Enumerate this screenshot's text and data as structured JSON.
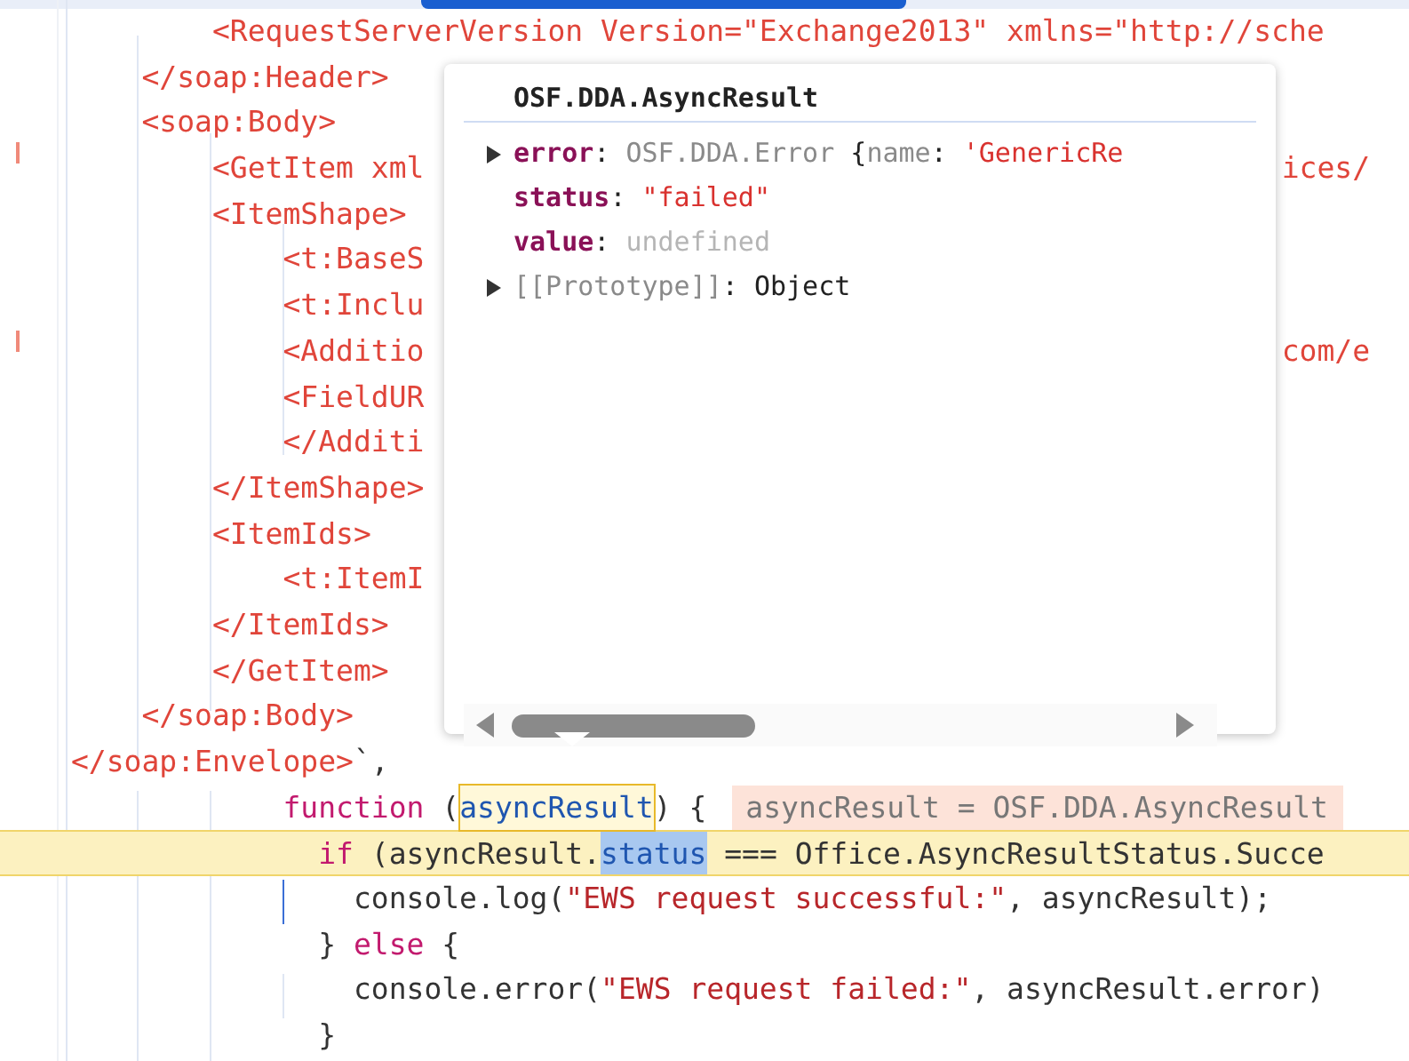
{
  "editor": {
    "lines": [
      {
        "current": false,
        "segments": [
          {
            "kind": "tag",
            "text": "        <RequestServerVersion Version=\"Exchange2013\" xmlns=\"http://sche"
          }
        ]
      },
      {
        "current": false,
        "segments": [
          {
            "kind": "tag",
            "text": "    </soap:Header>"
          }
        ]
      },
      {
        "current": false,
        "segments": [
          {
            "kind": "tag",
            "text": "    <soap:Body>"
          }
        ]
      },
      {
        "current": false,
        "segments": [
          {
            "kind": "tag",
            "text": "        <GetItem xml"
          }
        ],
        "right": [
          {
            "kind": "tag",
            "text": "ices/"
          }
        ]
      },
      {
        "current": false,
        "segments": [
          {
            "kind": "tag",
            "text": "        <ItemShape>"
          }
        ]
      },
      {
        "current": false,
        "segments": [
          {
            "kind": "tag",
            "text": "            <t:BaseS"
          }
        ]
      },
      {
        "current": false,
        "segments": [
          {
            "kind": "tag",
            "text": "            <t:Inclu"
          }
        ]
      },
      {
        "current": false,
        "segments": [
          {
            "kind": "tag",
            "text": "            <Additio"
          }
        ],
        "right": [
          {
            "kind": "tag",
            "text": "com/e"
          }
        ]
      },
      {
        "current": false,
        "segments": [
          {
            "kind": "tag",
            "text": "            <FieldUR"
          }
        ]
      },
      {
        "current": false,
        "segments": [
          {
            "kind": "tag",
            "text": "            </Additi"
          }
        ]
      },
      {
        "current": false,
        "segments": [
          {
            "kind": "tag",
            "text": "        </ItemShape>"
          }
        ]
      },
      {
        "current": false,
        "segments": [
          {
            "kind": "tag",
            "text": "        <ItemIds>"
          }
        ]
      },
      {
        "current": false,
        "segments": [
          {
            "kind": "tag",
            "text": "            <t:ItemI"
          }
        ]
      },
      {
        "current": false,
        "segments": [
          {
            "kind": "tag",
            "text": "        </ItemIds>"
          }
        ]
      },
      {
        "current": false,
        "segments": [
          {
            "kind": "tag",
            "text": "        </GetItem>"
          }
        ]
      },
      {
        "current": false,
        "segments": [
          {
            "kind": "tag",
            "text": "    </soap:Body>"
          }
        ]
      },
      {
        "current": false,
        "segments": [
          {
            "kind": "tag",
            "text": "</soap:Envelope>"
          },
          {
            "kind": "plain",
            "text": "`,"
          }
        ]
      },
      {
        "current": false,
        "segments": [
          {
            "kind": "keyword",
            "text": "            function"
          },
          {
            "kind": "plain",
            "text": " ("
          },
          {
            "kind": "match",
            "text": "asyncResult"
          },
          {
            "kind": "plain",
            "text": ") {"
          },
          {
            "kind": "hint",
            "text": "asyncResult = OSF.DDA.AsyncResult"
          }
        ]
      },
      {
        "current": true,
        "segments": [
          {
            "kind": "keyword",
            "text": "              if"
          },
          {
            "kind": "plain",
            "text": " (asyncResult."
          },
          {
            "kind": "selected",
            "text": "status"
          },
          {
            "kind": "plain",
            "text": " === Office.AsyncResultStatus.Succe"
          }
        ]
      },
      {
        "current": false,
        "segments": [
          {
            "kind": "plain",
            "text": "                console.log("
          },
          {
            "kind": "string",
            "text": "\"EWS request successful:\""
          },
          {
            "kind": "plain",
            "text": ", asyncResult);"
          }
        ]
      },
      {
        "current": false,
        "segments": [
          {
            "kind": "plain",
            "text": "              } "
          },
          {
            "kind": "keyword",
            "text": "else"
          },
          {
            "kind": "plain",
            "text": " {"
          }
        ]
      },
      {
        "current": false,
        "segments": [
          {
            "kind": "plain",
            "text": "                console.error("
          },
          {
            "kind": "string",
            "text": "\"EWS request failed:\""
          },
          {
            "kind": "plain",
            "text": ", asyncResult.error)"
          }
        ]
      },
      {
        "current": false,
        "segments": [
          {
            "kind": "plain",
            "text": "              }"
          }
        ]
      }
    ]
  },
  "tooltip": {
    "title": "OSF.DDA.AsyncResult",
    "properties": [
      {
        "expanded": false,
        "segments": [
          {
            "kind": "key",
            "text": "error"
          },
          {
            "kind": "plain",
            "text": ": "
          },
          {
            "kind": "grey",
            "text": "OSF.DDA.Error "
          },
          {
            "kind": "plain",
            "text": "{"
          },
          {
            "kind": "grey",
            "text": "name"
          },
          {
            "kind": "plain",
            "text": ": "
          },
          {
            "kind": "string",
            "text": "'GenericRe"
          }
        ]
      },
      {
        "segments": [
          {
            "kind": "key",
            "text": "status"
          },
          {
            "kind": "plain",
            "text": ": "
          },
          {
            "kind": "string",
            "text": "\"failed\""
          }
        ]
      },
      {
        "segments": [
          {
            "kind": "key",
            "text": "value"
          },
          {
            "kind": "plain",
            "text": ": "
          },
          {
            "kind": "faint",
            "text": "undefined"
          }
        ]
      },
      {
        "expanded": false,
        "segments": [
          {
            "kind": "grey",
            "text": "[[Prototype]]"
          },
          {
            "kind": "plain",
            "text": ": Object"
          }
        ]
      }
    ]
  }
}
